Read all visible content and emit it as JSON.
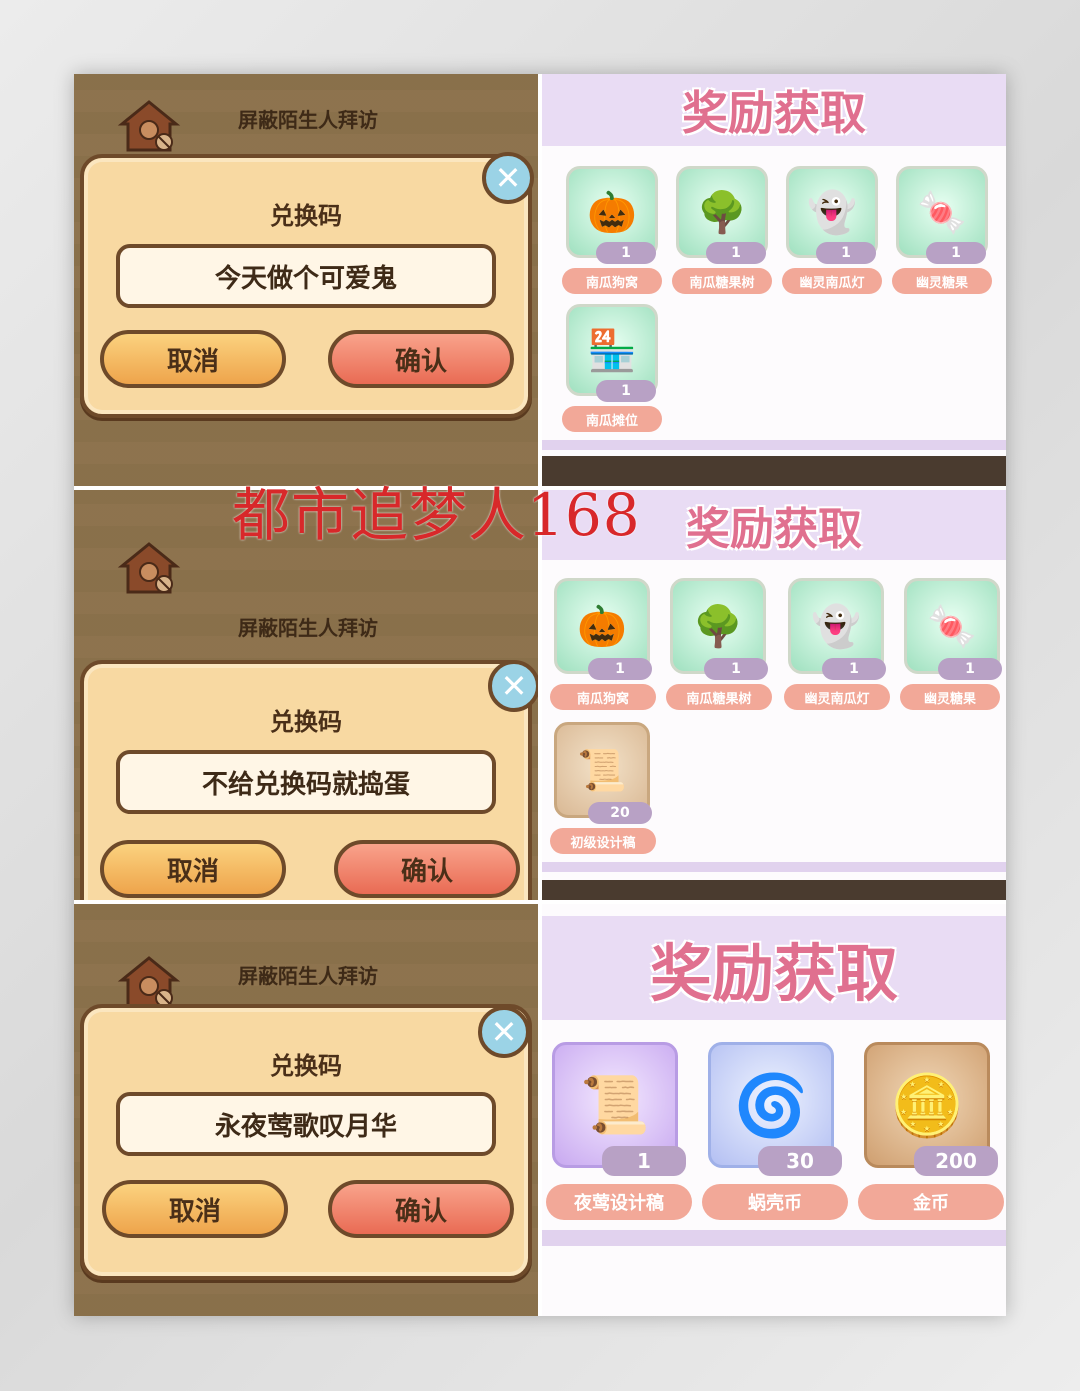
{
  "watermark": "都市追梦人168",
  "panels": [
    {
      "background_label": "屏蔽陌生人拜访",
      "dialog": {
        "title": "兑换码",
        "code": "今天做个可爱鬼",
        "cancel": "取消",
        "confirm": "确认"
      },
      "reward_title": "奖励获取",
      "items": [
        {
          "name": "南瓜狗窝",
          "count": "1",
          "icon": "pumpkin-doghouse-icon"
        },
        {
          "name": "南瓜糖果树",
          "count": "1",
          "icon": "pumpkin-candy-tree-icon"
        },
        {
          "name": "幽灵南瓜灯",
          "count": "1",
          "icon": "ghost-pumpkin-lantern-icon"
        },
        {
          "name": "幽灵糖果",
          "count": "1",
          "icon": "ghost-candy-icon"
        },
        {
          "name": "南瓜摊位",
          "count": "1",
          "icon": "pumpkin-stall-icon"
        }
      ]
    },
    {
      "background_label": "屏蔽陌生人拜访",
      "dialog": {
        "title": "兑换码",
        "code": "不给兑换码就捣蛋",
        "cancel": "取消",
        "confirm": "确认"
      },
      "reward_title": "奖励获取",
      "items": [
        {
          "name": "南瓜狗窝",
          "count": "1",
          "icon": "pumpkin-doghouse-icon"
        },
        {
          "name": "南瓜糖果树",
          "count": "1",
          "icon": "pumpkin-candy-tree-icon"
        },
        {
          "name": "幽灵南瓜灯",
          "count": "1",
          "icon": "ghost-pumpkin-lantern-icon"
        },
        {
          "name": "幽灵糖果",
          "count": "1",
          "icon": "ghost-candy-icon"
        },
        {
          "name": "初级设计稿",
          "count": "20",
          "icon": "design-scroll-icon"
        }
      ]
    },
    {
      "background_label": "屏蔽陌生人拜访",
      "dialog": {
        "title": "兑换码",
        "code": "永夜莺歌叹月华",
        "cancel": "取消",
        "confirm": "确认"
      },
      "reward_title": "奖励获取",
      "items": [
        {
          "name": "夜莺设计稿",
          "count": "1",
          "icon": "nightingale-design-scroll-icon"
        },
        {
          "name": "蜗壳币",
          "count": "30",
          "icon": "snail-shell-coin-icon"
        },
        {
          "name": "金币",
          "count": "200",
          "icon": "gold-coin-icon"
        }
      ]
    }
  ],
  "colors": {
    "dialog_bg": "#f8d9a2",
    "dialog_border": "#6e4a2a",
    "cancel_button": "#eea44b",
    "confirm_button": "#e96b54",
    "reward_header_bg": "#e9dcf4",
    "reward_title": "#e0708f",
    "name_pill": "#f2a898",
    "count_pill": "#b8a1c5",
    "watermark": "#d8282a"
  }
}
